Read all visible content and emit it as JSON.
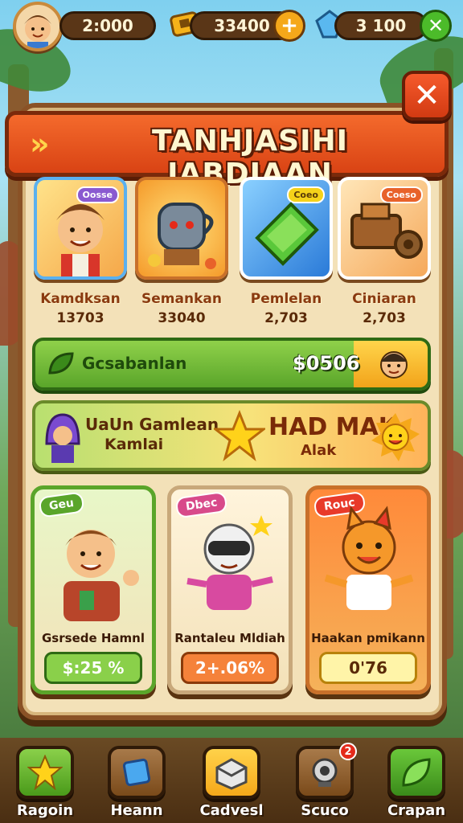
{
  "topbar": {
    "coins_value": "2:000",
    "cash_value": "33400",
    "gems_value": "3 100"
  },
  "panel": {
    "title": "TANHJASIHI IABDIAAN"
  },
  "items": [
    {
      "badge": "Oosse",
      "name": "Kamdksan",
      "value": "13703",
      "icon": "boy-portrait-icon"
    },
    {
      "badge": "",
      "name": "Semankan",
      "value": "33040",
      "icon": "robot-pot-icon"
    },
    {
      "badge": "Coeo",
      "name": "Pemlelan",
      "value": "2,703",
      "icon": "green-book-icon"
    },
    {
      "badge": "Coeso",
      "name": "Ciniaran",
      "value": "2,703",
      "icon": "wooden-cart-icon"
    }
  ],
  "progress": {
    "label": "Gcsabanlan",
    "amount": "$0506"
  },
  "event_banner": {
    "line1": "UaUn Gamlean",
    "line2": "Kamlai",
    "headline": "HAD MAK",
    "subline": "Alak"
  },
  "offers": [
    {
      "tag": "Geu",
      "name": "Gsrsede Hamnl",
      "price": "$:25 %",
      "icon": "waving-boy-icon"
    },
    {
      "tag": "Dbec",
      "name": "Rantaleu Mldiah",
      "price": "2+.06%",
      "icon": "goggle-robot-icon"
    },
    {
      "tag": "Rouc",
      "name": "Haakan pmikann",
      "price": "0'76",
      "icon": "orange-cat-icon"
    }
  ],
  "nav": [
    {
      "label": "Ragoin",
      "icon": "star-face-icon"
    },
    {
      "label": "Heann",
      "icon": "blue-gem-icon"
    },
    {
      "label": "Cadvesl",
      "icon": "box-icon"
    },
    {
      "label": "Scuco",
      "icon": "camera-icon",
      "badge": "2"
    },
    {
      "label": "Crapan",
      "icon": "leaf-icon"
    }
  ],
  "colors": {
    "accent_orange": "#f46a2c",
    "panel_bg": "#f3e1b8",
    "progress_green": "#5aa52a",
    "close_red": "#d23a12"
  }
}
